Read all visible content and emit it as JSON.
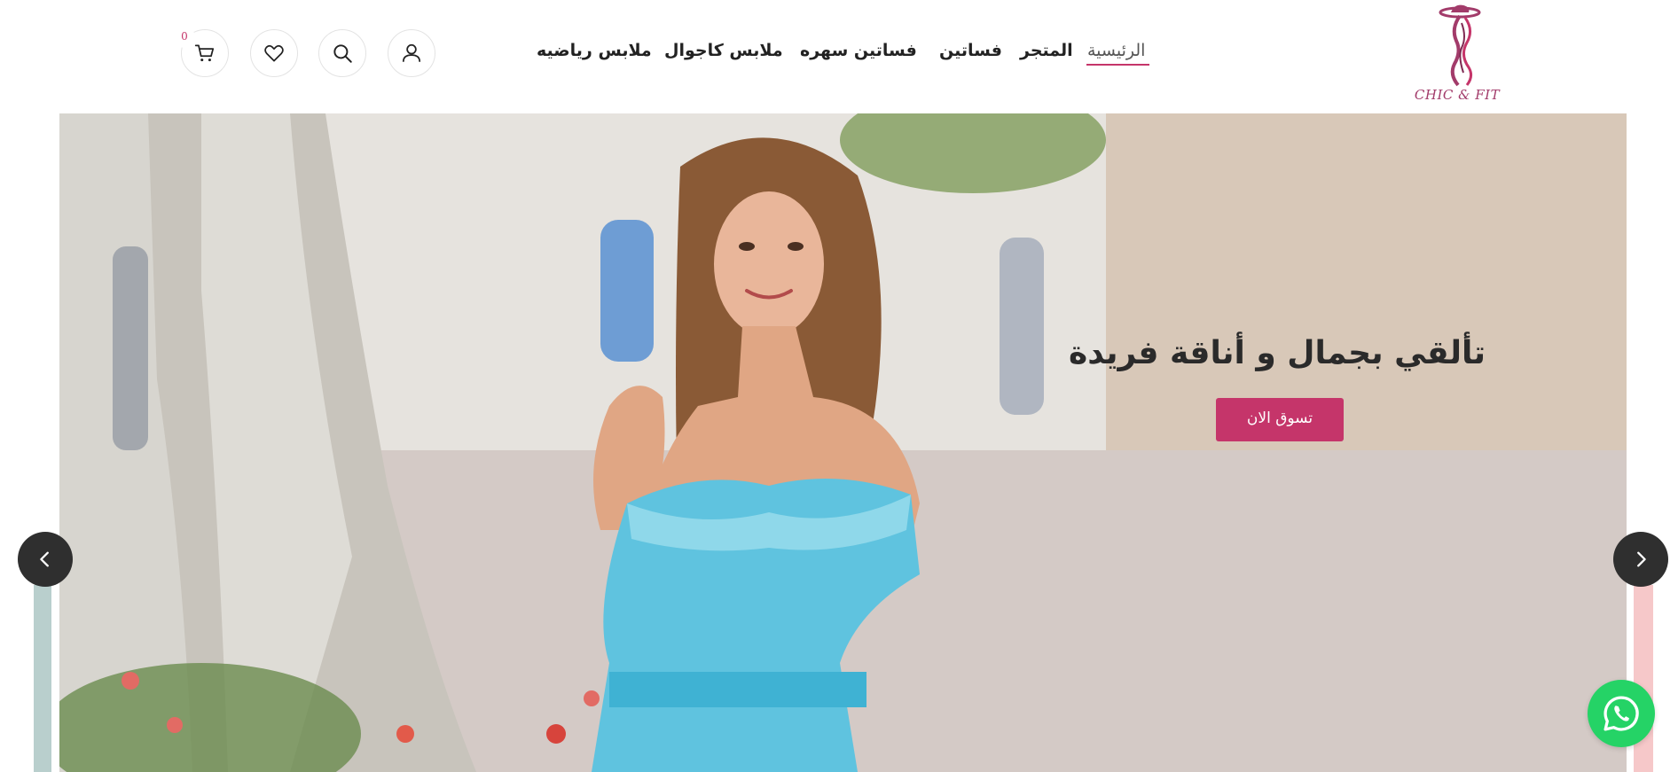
{
  "brand": {
    "logo_text": "CHIC & FIT",
    "accent": "#c5356a",
    "logo_color": "#a23b6a"
  },
  "nav": {
    "items": [
      {
        "label": "الرئيسية",
        "active": true
      },
      {
        "label": "المتجر"
      },
      {
        "label": "فساتين"
      },
      {
        "label": "فساتين سهره"
      },
      {
        "label": "ملابس كاجوال"
      },
      {
        "label": "ملابس رياضيه"
      }
    ]
  },
  "header_icons": {
    "account": "user-icon",
    "search": "search-icon",
    "wishlist": "heart-icon",
    "cart": "cart-icon",
    "cart_count": "0"
  },
  "hero": {
    "title": "تألقي بجمال و أناقة فريدة",
    "cta_label": "تسوق الان",
    "prev_icon": "chevron-left-icon",
    "next_icon": "chevron-right-icon"
  },
  "whatsapp": {
    "icon": "whatsapp-icon",
    "color": "#25d366"
  }
}
